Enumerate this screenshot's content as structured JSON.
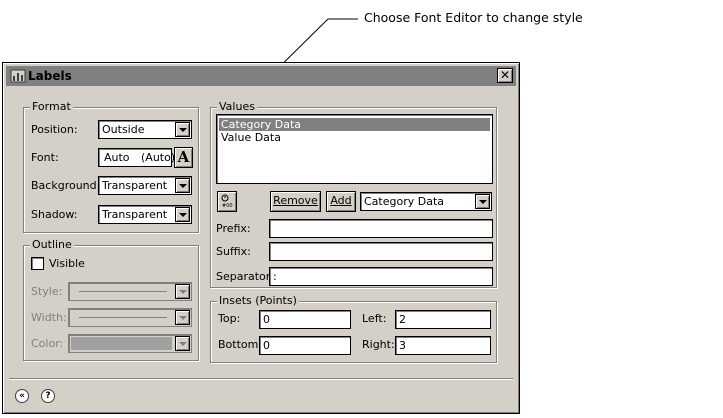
{
  "callout": {
    "text": "Choose Font Editor to change style"
  },
  "window": {
    "title": "Labels",
    "close_glyph": "✕"
  },
  "format": {
    "group_label": "Format",
    "position_label": "Position:",
    "position_value": "Outside",
    "font_label": "Font:",
    "font_value": "Auto",
    "font_value2": "(Auto)",
    "font_button": "A",
    "background_label": "Background:",
    "background_value": "Transparent",
    "shadow_label": "Shadow:",
    "shadow_value": "Transparent"
  },
  "outline": {
    "group_label": "Outline",
    "visible_label": "Visible",
    "visible_checked": false,
    "style_label": "Style:",
    "width_label": "Width:",
    "color_label": "Color:"
  },
  "values": {
    "group_label": "Values",
    "list_items": [
      "Category Data",
      "Value Data"
    ],
    "selected_index": 0,
    "remove_button": "Remove",
    "add_button": "Add",
    "type_value": "Category Data",
    "prefix_label": "Prefix:",
    "prefix_value": "",
    "suffix_label": "Suffix:",
    "suffix_value": "",
    "separator_label": "Separator:",
    "separator_value": ":"
  },
  "insets": {
    "group_label": "Insets (Points)",
    "top_label": "Top:",
    "top_value": "0",
    "left_label": "Left:",
    "left_value": "2",
    "bottom_label": "Bottom:",
    "bottom_value": "0",
    "right_label": "Right:",
    "right_value": "3"
  },
  "footer": {
    "collapse_glyph": "«",
    "help_glyph": "?"
  }
}
